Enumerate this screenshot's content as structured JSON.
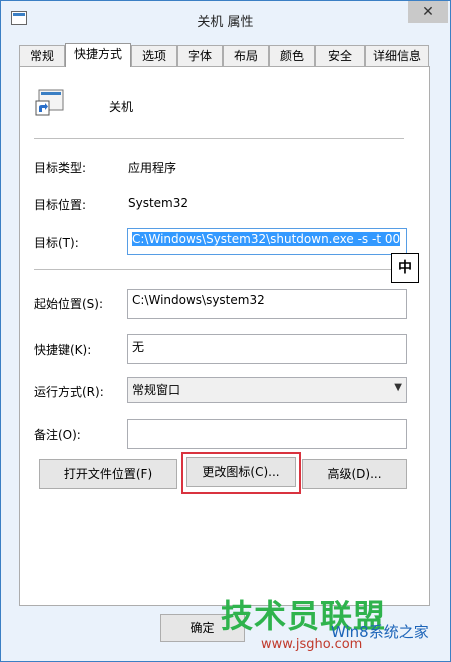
{
  "window": {
    "title": "关机 属性",
    "close_glyph": "✕"
  },
  "tabs": [
    {
      "label": "常规"
    },
    {
      "label": "快捷方式"
    },
    {
      "label": "选项"
    },
    {
      "label": "字体"
    },
    {
      "label": "布局"
    },
    {
      "label": "颜色"
    },
    {
      "label": "安全"
    },
    {
      "label": "详细信息"
    }
  ],
  "shortcut": {
    "name": "关机",
    "target_type_label": "目标类型:",
    "target_type_value": "应用程序",
    "target_location_label": "目标位置:",
    "target_location_value": "System32",
    "target_label": "目标(T):",
    "target_value": "C:\\Windows\\System32\\shutdown.exe -s -t 00",
    "start_in_label": "起始位置(S):",
    "start_in_value": "C:\\Windows\\system32",
    "hotkey_label": "快捷键(K):",
    "hotkey_value": "无",
    "run_label": "运行方式(R):",
    "run_value": "常规窗口",
    "comment_label": "备注(O):",
    "comment_value": ""
  },
  "buttons": {
    "open_location": "打开文件位置(F)",
    "change_icon": "更改图标(C)...",
    "advanced": "高级(D)...",
    "ok": "确定"
  },
  "ime": {
    "mode": "中"
  },
  "watermark": {
    "text": "技术员联盟",
    "sub": "Win8系统之家",
    "url": "www.jsgho.com"
  },
  "colors": {
    "accent": "#3399ff",
    "highlight": "#d9333f",
    "watermark": "#2fb34d"
  }
}
